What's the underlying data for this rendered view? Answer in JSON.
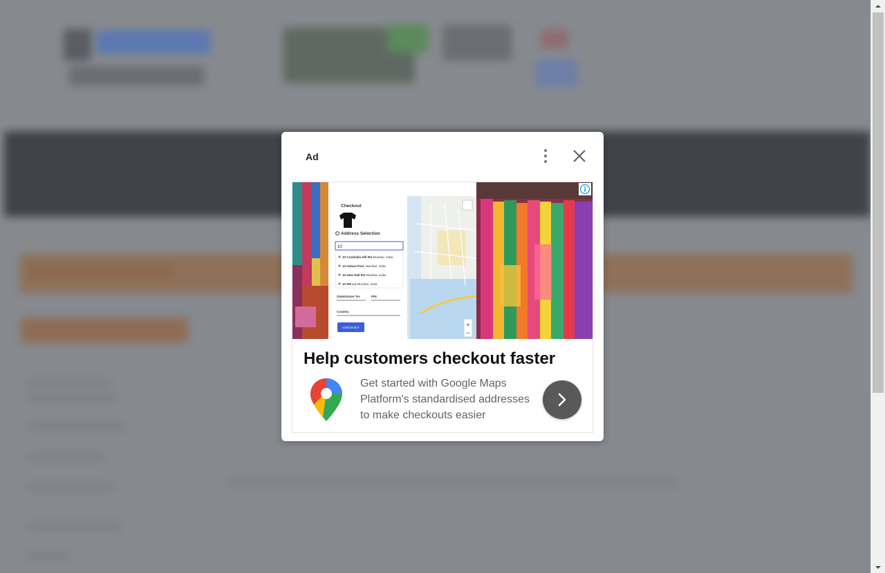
{
  "ad": {
    "label": "Ad",
    "headline": "Help customers checkout faster",
    "body": "Get started with Google Maps Platform's standardised addresses to make checkouts easier",
    "hero": {
      "card_title": "Checkout",
      "section_title": "Address Selection",
      "search_value": "10",
      "suggestions": [
        {
          "main": "10 Cumballa Hill Rd",
          "sub": "Mumbai, India"
        },
        {
          "main": "10 Halow Pool,",
          "sub": "Mumbai, India"
        },
        {
          "main": "10 New Hall Rd",
          "sub": "Mumbai, India"
        },
        {
          "main": "10 5th Ln",
          "sub": "Mumbai, India"
        }
      ],
      "field_state": "State/Union Ter",
      "field_pin": "PIN",
      "field_country": "Country",
      "checkout_button": "CHECKOUT",
      "zoom_in": "+",
      "zoom_out": "−"
    }
  },
  "icons": {
    "menu": "vertical-dots-icon",
    "close": "close-icon",
    "info": "info-icon",
    "logo": "google-maps-pin-icon",
    "cta": "chevron-right-icon"
  },
  "colors": {
    "overlay": "#878a8f",
    "cta_button": "#595959",
    "headline": "#111111",
    "body_text": "#5f6368",
    "checkout_button": "#3b5fd9",
    "info_icon": "#1a9bd7"
  }
}
